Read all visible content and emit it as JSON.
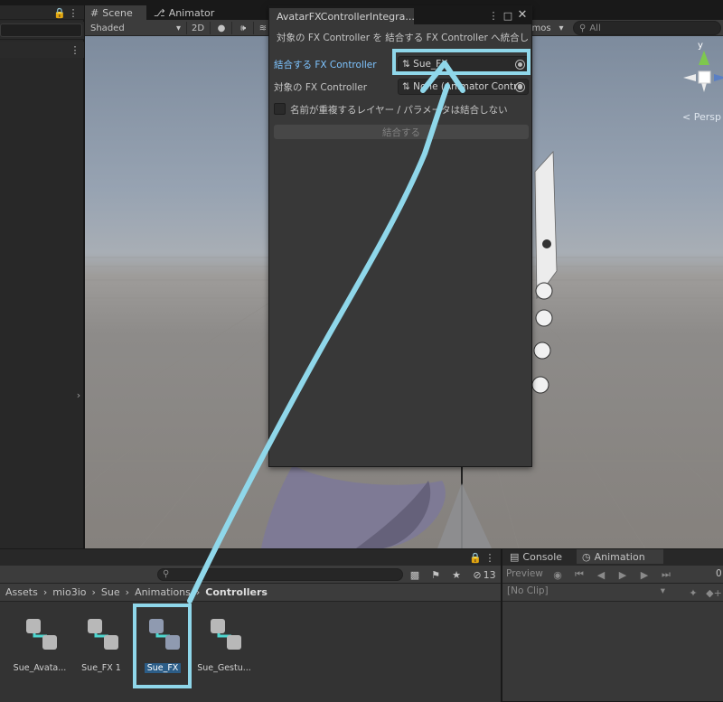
{
  "hierarchy": {
    "lock_icon": "lock-icon",
    "menu_icon": "kebab-icon"
  },
  "scene_tabs": [
    {
      "label": "Scene",
      "icon": "grid-icon"
    },
    {
      "label": "Animator",
      "icon": "animator-icon"
    }
  ],
  "scene_toolbar": {
    "shading": "Shaded",
    "mode_2d": "2D",
    "gizmos": "mos",
    "search_placeholder": "All"
  },
  "viewport": {
    "camera_mode": "< Persp",
    "axis_label": "y"
  },
  "fx_window": {
    "title": "AvatarFXControllerIntegra...",
    "description": "対象の FX Controller を 結合する FX Controller へ統合しま す",
    "source_label": "結合する FX Controller",
    "source_value": "Sue_FX",
    "target_label": "対象の FX Controller",
    "target_value": "None (Animator Contro",
    "checkbox_label": "名前が重複するレイヤー / パラメータは結合しない",
    "checkbox_checked": false,
    "merge_button": "結合する"
  },
  "project": {
    "hidden_count": "13",
    "breadcrumb": [
      "Assets",
      "mio3io",
      "Sue",
      "Animations"
    ],
    "breadcrumb_current": "Controllers",
    "assets": [
      {
        "name": "Sue_Avata..."
      },
      {
        "name": "Sue_FX 1"
      },
      {
        "name": "Sue_FX",
        "selected": true
      },
      {
        "name": "Sue_Gestu..."
      }
    ]
  },
  "console_panel": {
    "tabs": [
      "Console",
      "Animation"
    ],
    "preview_label": "Preview",
    "clip": "[No Clip]",
    "frame": "0"
  },
  "colors": {
    "annotation": "#8fd7ea",
    "selected_label": "#7ec4ff",
    "accent_selection": "#2c5d87"
  }
}
